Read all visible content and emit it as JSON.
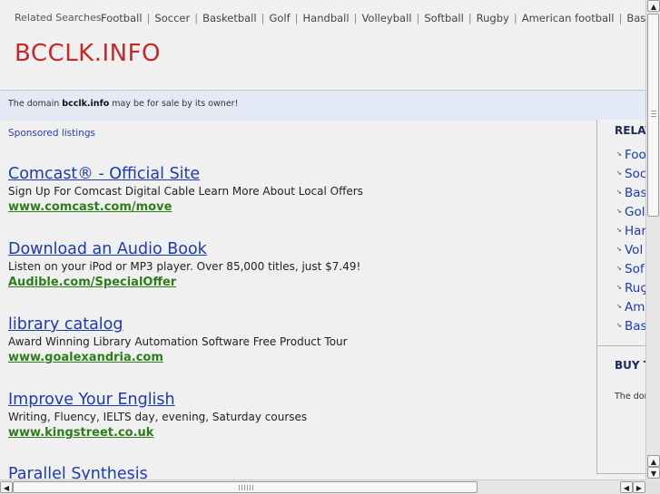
{
  "related_searches": {
    "title": "Related Searches",
    "items": [
      "Football",
      "Soccer",
      "Basketball",
      "Golf",
      "Handball",
      "Volleyball",
      "Softball",
      "Rugby",
      "American football",
      "Baseball"
    ],
    "separator": "|"
  },
  "logo": "BCCLK.INFO",
  "sale_notice": {
    "prefix": "The domain ",
    "domain": "bcclk.info",
    "suffix": " may be for sale by its owner!"
  },
  "sponsored_label": "Sponsored listings",
  "listings": [
    {
      "title": "Comcast® - Official Site",
      "desc": "Sign Up For Comcast Digital Cable Learn More About Local Offers",
      "url": "www.comcast.com/move"
    },
    {
      "title": "Download an Audio Book",
      "desc": "Listen on your iPod or MP3 player. Over 85,000 titles, just $7.49!",
      "url": "Audible.com/SpecialOffer"
    },
    {
      "title": "library catalog",
      "desc": "Award Winning Library Automation Software Free Product Tour",
      "url": "www.goalexandria.com"
    },
    {
      "title": "Improve Your English",
      "desc": "Writing, Fluency, IELTS day, evening, Saturday courses",
      "url": "www.kingstreet.co.uk"
    },
    {
      "title": "Parallel Synthesis",
      "desc": "",
      "url": ""
    }
  ],
  "right_panel": {
    "heading": "RELAT",
    "items": [
      "Foo",
      "Soc",
      "Bas",
      "Gol",
      "Har",
      "Vol",
      "Sof",
      "Ruç",
      "Am",
      "Bas"
    ],
    "buy_heading": "BUY T",
    "buy_text": "The dom"
  },
  "scrollbar": {
    "up_icon": "▲",
    "down_icon": "▼",
    "left_icon": "◀",
    "right_icon": "▶"
  },
  "colors": {
    "logo": "#c62828",
    "link": "#1a3bb3",
    "url": "#2e7d1b",
    "sale_bar": "#e3e9f5"
  }
}
